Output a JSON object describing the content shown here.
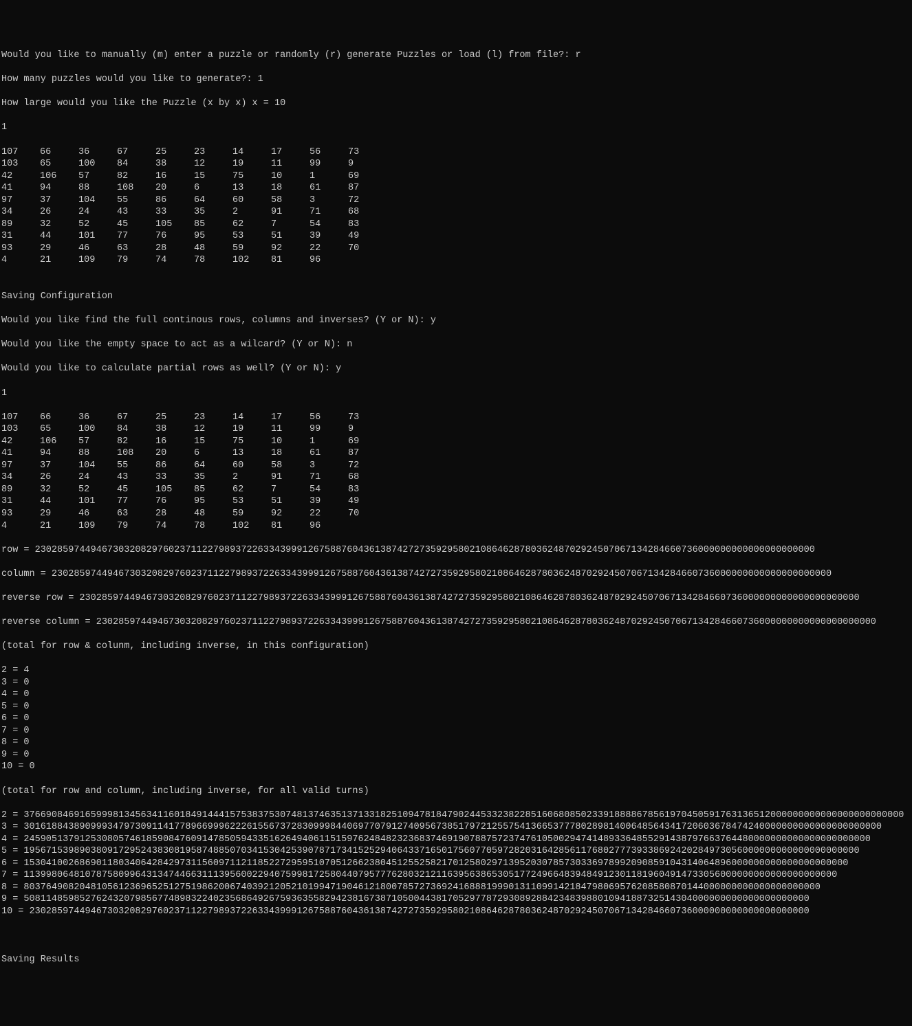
{
  "prompts": {
    "manual_or_random": "Would you like to manually (m) enter a puzzle or randomly (r) generate Puzzles or load (l) from file?: ",
    "manual_or_random_answer": "r",
    "how_many": "How many puzzles would you like to generate?: ",
    "how_many_answer": "1",
    "how_large": "How large would you like the Puzzle (x by x) x = ",
    "how_large_answer": "10"
  },
  "puzzle_number_1": "1",
  "grid1": [
    [
      "107",
      "66",
      "36",
      "67",
      "25",
      "23",
      "14",
      "17",
      "56",
      "73"
    ],
    [
      "103",
      "65",
      "100",
      "84",
      "38",
      "12",
      "19",
      "11",
      "99",
      "9"
    ],
    [
      "42",
      "106",
      "57",
      "82",
      "16",
      "15",
      "75",
      "10",
      "1",
      "69"
    ],
    [
      "41",
      "94",
      "88",
      "108",
      "20",
      "6",
      "13",
      "18",
      "61",
      "87"
    ],
    [
      "97",
      "37",
      "104",
      "55",
      "86",
      "64",
      "60",
      "58",
      "3",
      "72"
    ],
    [
      "34",
      "26",
      "24",
      "43",
      "33",
      "35",
      "2",
      "91",
      "71",
      "68"
    ],
    [
      "89",
      "32",
      "52",
      "45",
      "105",
      "85",
      "62",
      "7",
      "54",
      "83"
    ],
    [
      "31",
      "44",
      "101",
      "77",
      "76",
      "95",
      "53",
      "51",
      "39",
      "49"
    ],
    [
      "93",
      "29",
      "46",
      "63",
      "28",
      "48",
      "59",
      "92",
      "22",
      "70"
    ],
    [
      "4",
      "21",
      "109",
      "79",
      "74",
      "78",
      "102",
      "81",
      "96"
    ]
  ],
  "blank_line_1": "",
  "saving_config": "Saving Configuration",
  "prompts2": {
    "find_full": "Would you like find the full continous rows, columns and inverses? (Y or N): ",
    "find_full_answer": "y",
    "empty_space": "Would you like the empty space to act as a wilcard? (Y or N): ",
    "empty_space_answer": "n",
    "partial_rows": "Would you like to calculate partial rows as well? (Y or N): ",
    "partial_rows_answer": "y"
  },
  "puzzle_number_2": "1",
  "grid2": [
    [
      "107",
      "66",
      "36",
      "67",
      "25",
      "23",
      "14",
      "17",
      "56",
      "73"
    ],
    [
      "103",
      "65",
      "100",
      "84",
      "38",
      "12",
      "19",
      "11",
      "99",
      "9"
    ],
    [
      "42",
      "106",
      "57",
      "82",
      "16",
      "15",
      "75",
      "10",
      "1",
      "69"
    ],
    [
      "41",
      "94",
      "88",
      "108",
      "20",
      "6",
      "13",
      "18",
      "61",
      "87"
    ],
    [
      "97",
      "37",
      "104",
      "55",
      "86",
      "64",
      "60",
      "58",
      "3",
      "72"
    ],
    [
      "34",
      "26",
      "24",
      "43",
      "33",
      "35",
      "2",
      "91",
      "71",
      "68"
    ],
    [
      "89",
      "32",
      "52",
      "45",
      "105",
      "85",
      "62",
      "7",
      "54",
      "83"
    ],
    [
      "31",
      "44",
      "101",
      "77",
      "76",
      "95",
      "53",
      "51",
      "39",
      "49"
    ],
    [
      "93",
      "29",
      "46",
      "63",
      "28",
      "48",
      "59",
      "92",
      "22",
      "70"
    ],
    [
      "4",
      "21",
      "109",
      "79",
      "74",
      "78",
      "102",
      "81",
      "96"
    ]
  ],
  "results": {
    "row": "row = 23028597449467303208297602371122798937226334399912675887604361387427273592958021086462878036248702924507067134284660736000000000000000000000",
    "column": "column = 23028597449467303208297602371122798937226334399912675887604361387427273592958021086462878036248702924507067134284660736000000000000000000000",
    "reverse_row": "reverse row = 23028597449467303208297602371122798937226334399912675887604361387427273592958021086462878036248702924507067134284660736000000000000000000000",
    "reverse_column": "reverse column = 23028597449467303208297602371122798937226334399912675887604361387427273592958021086462878036248702924507067134284660736000000000000000000000"
  },
  "total_header_1": "(total for row & colunm, including inverse, in this configuration)",
  "config_totals": [
    "2 = 4",
    "3 = 0",
    "4 = 0",
    "5 = 0",
    "6 = 0",
    "7 = 0",
    "8 = 0",
    "9 = 0",
    "10 = 0"
  ],
  "total_header_2": "(total for row and column, including inverse, for all valid turns)",
  "turn_totals": [
    "2 = 37669084691659998134563411601849144415753837530748137463513713318251094781847902445332382285160680850233918888678561970450591763136512000000000000000000000000",
    "3 = 3016188438909993479730911417789669996222615567372830999844069770791274095673851797212557541366537778028981400648564341720603678474240000000000000000000000",
    "4 = 24590513791253080574618590847609147850594335162649406115159762484823236837469190788757237476105002947414893364855291438797663764480000000000000000000000",
    "5 = 195671539890380917295243830819587488507034153042539078717341525294064337165017560770597282031642856117680277739338692420284973056000000000000000000000",
    "6 = 1530410026869011803406428429731156097112118522729595107051266238045125525821701258029713952030785730336978992090859104314064896000000000000000000000",
    "7 = 11399806481078758099643134744663111395600229407599817258044079577762803212116395638653051772496648394849123011819604914733056000000000000000000000",
    "8 = 80376490820481056123696525127519862006740392120521019947190461218007857273692416888199901311099142184798069576208580870144000000000000000000000",
    "9 = 508114859852762432079856774898322402356864926759363558294238167387105004438170529778729308928842348398801094188732514304000000000000000000000",
    "10 = 23028597449467303208297602371122798937226334399912675887604361387427273592958021086462878036248702924507067134284660736000000000000000000000"
  ],
  "blank_line_2": "",
  "blank_line_3": "",
  "saving_results": "Saving Results"
}
